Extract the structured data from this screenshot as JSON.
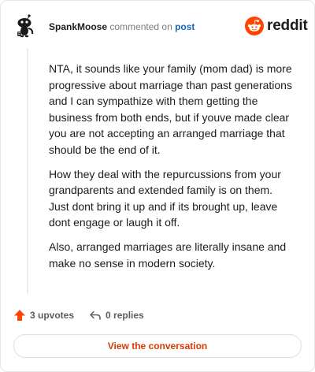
{
  "header": {
    "username": "SpankMoose",
    "commented_text": "commented on",
    "post_link": "post",
    "brand": "reddit"
  },
  "comment": {
    "paragraphs": [
      "NTA, it sounds like your family (mom dad) is more progressive about marriage than past generations and I can sympathize with them getting the business from both ends, but if youve made clear you are not accepting an arranged marriage that should be the end of it.",
      "How they deal with the repurcussions from your grandparents and extended family is on them. Just dont bring it up and if its brought up, leave dont engage or laugh it off.",
      "Also, arranged marriages are literally insane and make no sense in modern society."
    ]
  },
  "actions": {
    "upvotes": "3 upvotes",
    "replies": "0 replies"
  },
  "cta": {
    "label": "View the conversation"
  },
  "colors": {
    "upvote": "#ff4500",
    "link": "#1a66b8",
    "cta_text": "#d93a00",
    "brand_orange": "#ff4500"
  },
  "icons": {
    "avatar": "snoo-avatar-icon",
    "brand": "reddit-logo-icon",
    "upvote": "upvote-arrow-icon",
    "reply": "reply-arrow-icon"
  }
}
